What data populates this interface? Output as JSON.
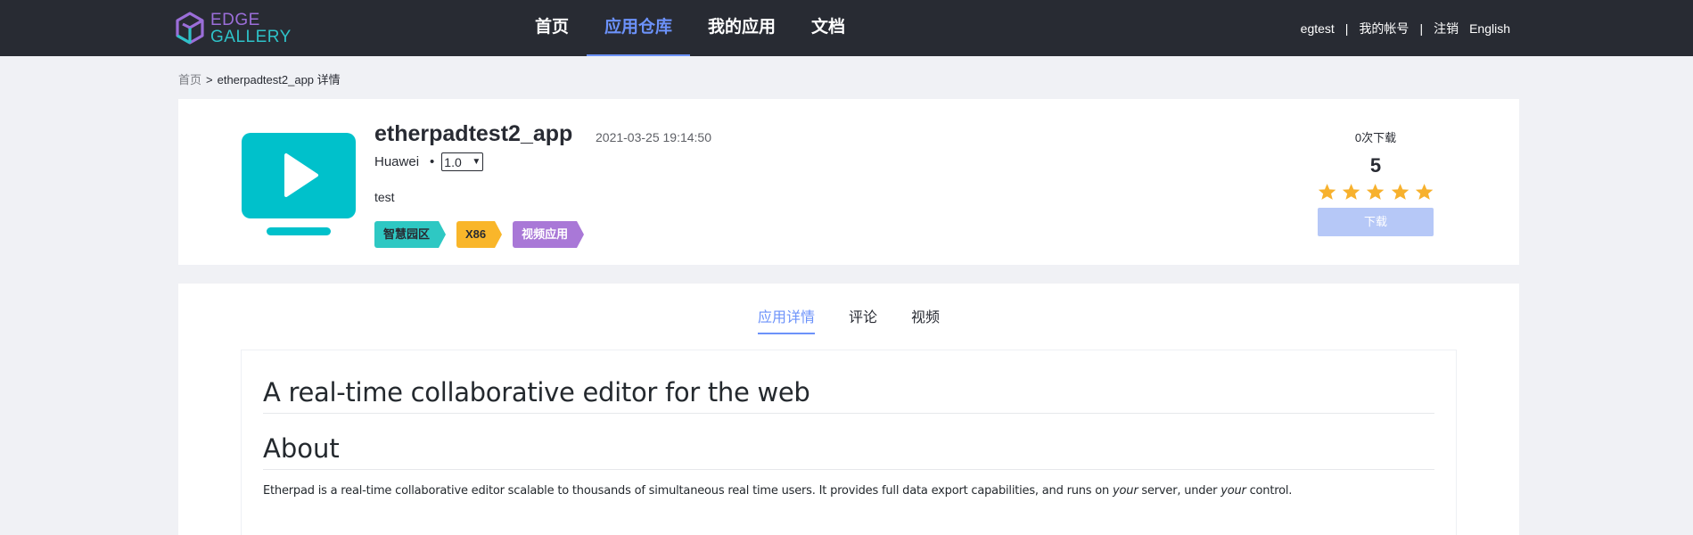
{
  "header": {
    "logo": {
      "line1": "EDGE",
      "line2": "GALLERY"
    },
    "nav": [
      {
        "label": "首页",
        "active": false
      },
      {
        "label": "应用仓库",
        "active": true
      },
      {
        "label": "我的应用",
        "active": false
      },
      {
        "label": "文档",
        "active": false
      }
    ],
    "user": {
      "username": "egtest",
      "separator": "|",
      "account": "我的帐号",
      "logout": "注销",
      "language": "English"
    }
  },
  "breadcrumb": {
    "home": "首页",
    "arrow": ">",
    "current": "etherpadtest2_app 详情"
  },
  "app": {
    "name": "etherpadtest2_app",
    "date": "2021-03-25 19:14:50",
    "provider": "Huawei",
    "dot": "•",
    "version": "1.0",
    "description": "test",
    "tags": [
      "智慧园区",
      "X86",
      "视频应用"
    ],
    "icon": "video-play-icon",
    "downloads_text": "0次下载",
    "score": "5",
    "rating": 5,
    "download_label": "下载",
    "colors": {
      "icon": "#00c1cb",
      "star": "#f7b12d",
      "accent": "#6c92fa"
    }
  },
  "detail": {
    "tabs": [
      {
        "label": "应用详情",
        "active": true
      },
      {
        "label": "评论",
        "active": false
      },
      {
        "label": "视频",
        "active": false
      }
    ],
    "readme": {
      "title": "A real-time collaborative editor for the web",
      "heading": "About",
      "para_start": "Etherpad is a real-time collaborative editor scalable to thousands of simultaneous real time users. It provides full data export capabilities, and runs on ",
      "para_em1": "your",
      "para_mid": " server, under ",
      "para_em2": "your",
      "para_end": " control."
    }
  }
}
